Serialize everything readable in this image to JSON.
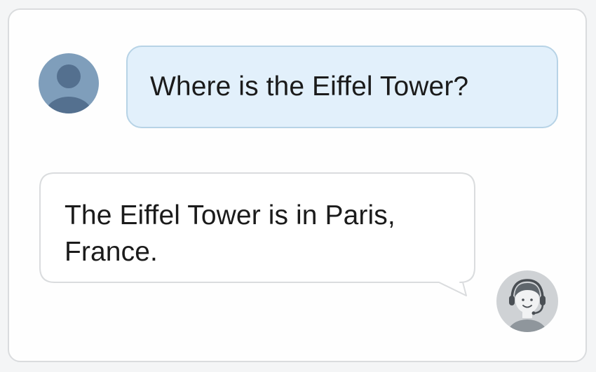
{
  "chat": {
    "messages": [
      {
        "sender": "user",
        "avatar_icon": "user-silhouette-icon",
        "text": "Where is the Eiffel Tower?"
      },
      {
        "sender": "agent",
        "avatar_icon": "support-agent-headset-icon",
        "text": "The Eiffel Tower is in Paris, France."
      }
    ]
  },
  "colors": {
    "user_bubble_bg": "#e2f0fb",
    "user_bubble_border": "#b7d3e6",
    "agent_bubble_bg": "#ffffff",
    "agent_bubble_border": "#dadcde",
    "user_avatar_bg": "#7f9ebb",
    "agent_avatar_bg": "#cfd2d5"
  }
}
